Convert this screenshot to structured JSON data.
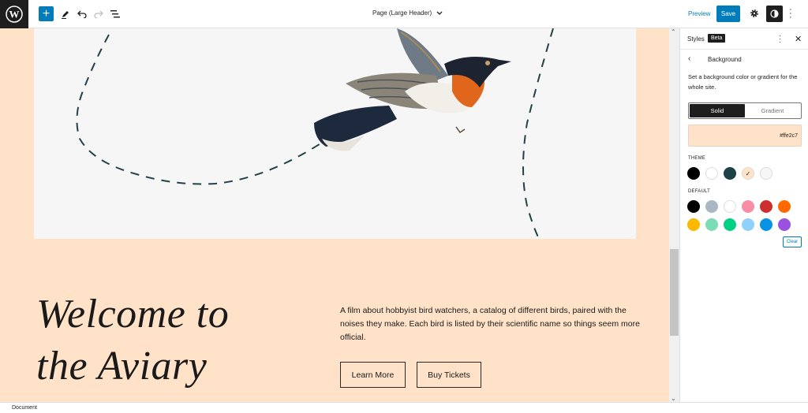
{
  "toolbar": {
    "logo": "wordpress-logo",
    "add_label": "+",
    "document_title": "Page (Large Header)",
    "preview_label": "Preview",
    "save_label": "Save"
  },
  "canvas": {
    "background_color": "#ffe2c7",
    "heading_line1": "Welcome to",
    "heading_line2": "the Aviary",
    "paragraph": "A film about hobbyist bird watchers, a catalog of different birds, paired with the noises they make. Each bird is listed by their scientific name so things seem more official.",
    "buttons": [
      {
        "label": "Learn More"
      },
      {
        "label": "Buy Tickets"
      }
    ]
  },
  "sidebar": {
    "title": "Styles",
    "badge": "Beta",
    "panel_title": "Background",
    "description": "Set a background color or gradient for the whole site.",
    "tabs": [
      {
        "label": "Solid",
        "active": true
      },
      {
        "label": "Gradient",
        "active": false
      }
    ],
    "current_color": "#ffe2c7",
    "theme_label": "THEME",
    "theme_colors": [
      {
        "name": "black",
        "hex": "#000000"
      },
      {
        "name": "white",
        "hex": "#ffffff"
      },
      {
        "name": "dark-teal",
        "hex": "#1d4146"
      },
      {
        "name": "peach",
        "hex": "#ffe2c7",
        "selected": true
      },
      {
        "name": "light-gray",
        "hex": "#f6f6f6"
      }
    ],
    "default_label": "DEFAULT",
    "default_colors": [
      {
        "name": "black",
        "hex": "#000000"
      },
      {
        "name": "cyan-bluish-gray",
        "hex": "#abb8c3"
      },
      {
        "name": "white",
        "hex": "#ffffff"
      },
      {
        "name": "pale-pink",
        "hex": "#f78da7"
      },
      {
        "name": "vivid-red",
        "hex": "#cf2e2e"
      },
      {
        "name": "luminous-vivid-orange",
        "hex": "#ff6900"
      },
      {
        "name": "luminous-vivid-amber",
        "hex": "#fcb900"
      },
      {
        "name": "light-green-cyan",
        "hex": "#7bdcb5"
      },
      {
        "name": "vivid-green-cyan",
        "hex": "#00d084"
      },
      {
        "name": "pale-cyan-blue",
        "hex": "#8ed1fc"
      },
      {
        "name": "vivid-cyan-blue",
        "hex": "#0693e3"
      },
      {
        "name": "vivid-purple",
        "hex": "#9b51e0"
      }
    ],
    "clear_label": "Clear"
  },
  "footer": {
    "breadcrumb": "Document"
  }
}
